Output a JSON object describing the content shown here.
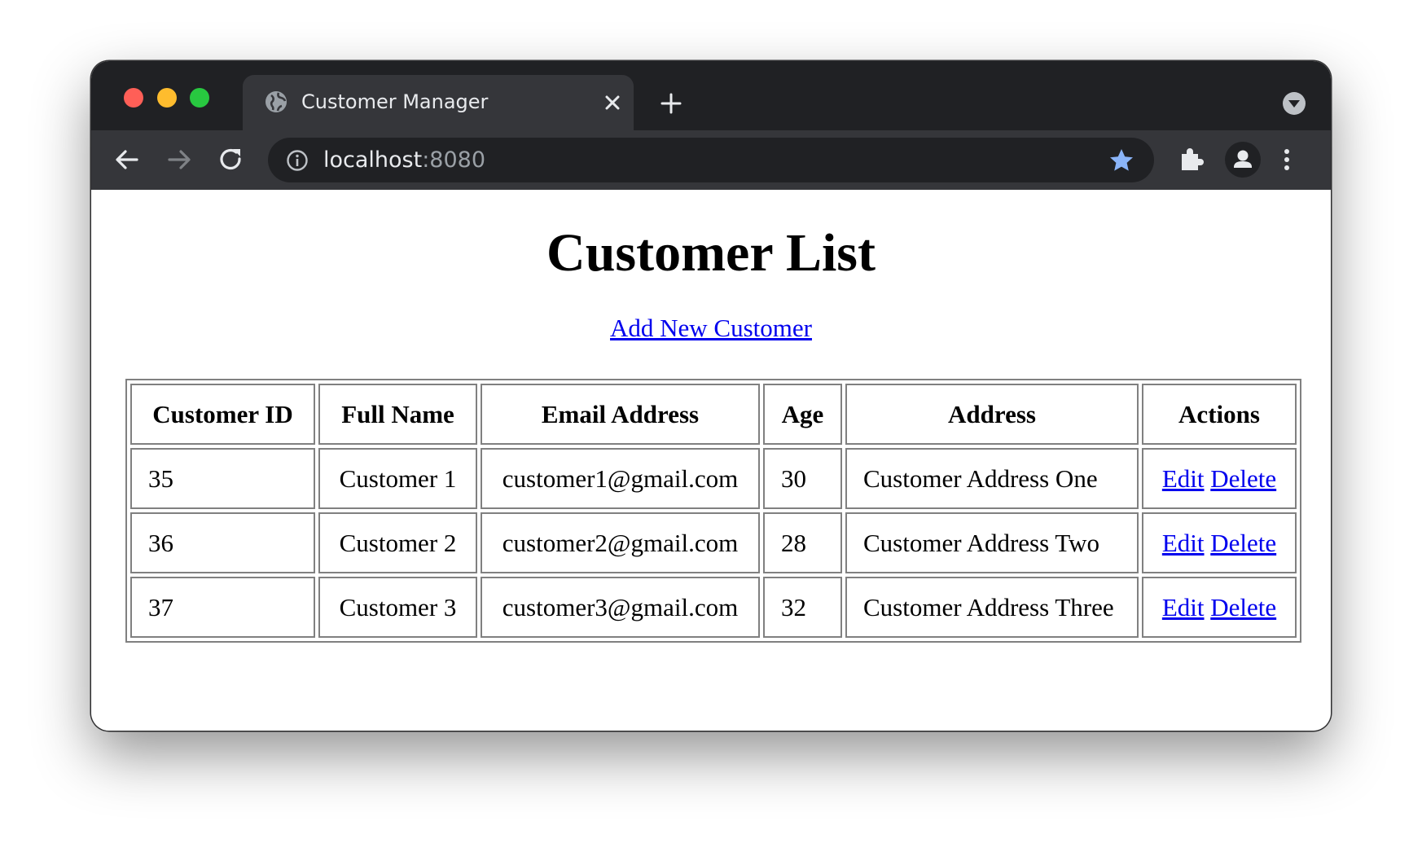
{
  "browser": {
    "tab_title": "Customer Manager",
    "url_host": "localhost",
    "url_port": ":8080",
    "accent_star": "#8ab4f8",
    "icons": [
      "globe-icon",
      "close-icon",
      "plus-icon",
      "chevron-down-icon",
      "back-arrow-icon",
      "forward-arrow-icon",
      "reload-icon",
      "info-icon",
      "star-icon",
      "puzzle-icon",
      "profile-icon",
      "kebab-menu-icon"
    ]
  },
  "page": {
    "title": "Customer List",
    "add_link": "Add New Customer",
    "link_color": "#0000ee"
  },
  "table": {
    "headers": [
      "Customer ID",
      "Full Name",
      "Email Address",
      "Age",
      "Address",
      "Actions"
    ],
    "rows": [
      {
        "id": "35",
        "name": "Customer 1",
        "email": "customer1@gmail.com",
        "age": "30",
        "address": "Customer Address One",
        "edit": "Edit",
        "delete": "Delete"
      },
      {
        "id": "36",
        "name": "Customer 2",
        "email": "customer2@gmail.com",
        "age": "28",
        "address": "Customer Address Two",
        "edit": "Edit",
        "delete": "Delete"
      },
      {
        "id": "37",
        "name": "Customer 3",
        "email": "customer3@gmail.com",
        "age": "32",
        "address": "Customer Address Three",
        "edit": "Edit",
        "delete": "Delete"
      }
    ]
  }
}
